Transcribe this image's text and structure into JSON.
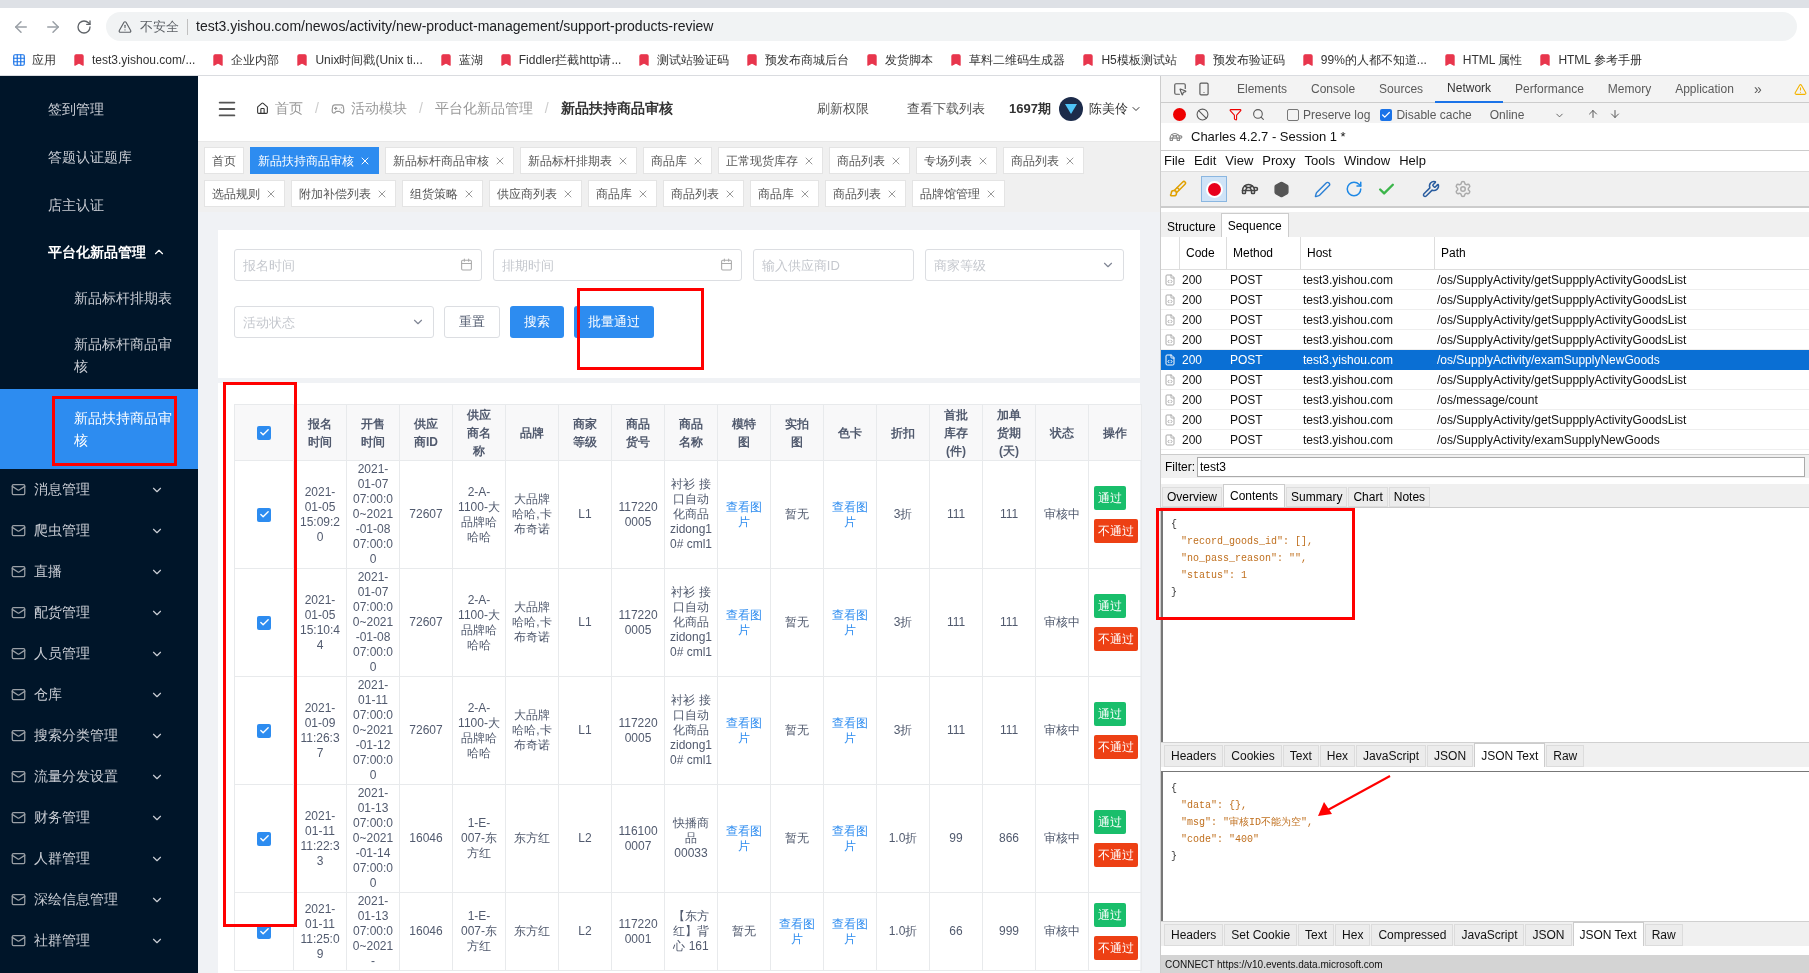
{
  "browser": {
    "security": "不安全",
    "url": "test3.yishou.com/newos/activity/new-product-management/support-products-review",
    "bookmarks": [
      {
        "kind": "apps",
        "label": "应用"
      },
      {
        "kind": "link",
        "label": "test3.yishou.com/..."
      },
      {
        "kind": "link",
        "label": "企业内部"
      },
      {
        "kind": "link",
        "label": "Unix时间戳(Unix ti..."
      },
      {
        "kind": "link",
        "label": "蓝湖"
      },
      {
        "kind": "link",
        "label": "Fiddler拦截http请..."
      },
      {
        "kind": "link",
        "label": "测试站验证码"
      },
      {
        "kind": "link",
        "label": "预发布商城后台"
      },
      {
        "kind": "link",
        "label": "发货脚本"
      },
      {
        "kind": "link",
        "label": "草料二维码生成器"
      },
      {
        "kind": "link",
        "label": "H5模板测试站"
      },
      {
        "kind": "link",
        "label": "预发布验证码"
      },
      {
        "kind": "link",
        "label": "99%的人都不知道..."
      },
      {
        "kind": "link",
        "label": "HTML 属性"
      },
      {
        "kind": "link",
        "label": "HTML 参考手册"
      }
    ]
  },
  "sidebar": {
    "items": [
      {
        "kind": "link",
        "label": "签到管理"
      },
      {
        "kind": "link",
        "label": "答题认证题库"
      },
      {
        "kind": "link",
        "label": "店主认证"
      },
      {
        "kind": "section",
        "label": "平台化新品管理",
        "expanded": true,
        "children": [
          {
            "label": "新品标杆排期表",
            "selected": false
          },
          {
            "label": "新品标杆商品审核",
            "selected": false
          },
          {
            "label": "新品扶持商品审核",
            "selected": true
          }
        ]
      },
      {
        "kind": "menu",
        "label": "消息管理",
        "expanded": false
      },
      {
        "kind": "menu",
        "label": "爬虫管理",
        "expanded": false
      },
      {
        "kind": "menu",
        "label": "直播",
        "expanded": false
      },
      {
        "kind": "menu",
        "label": "配货管理",
        "expanded": false
      },
      {
        "kind": "menu",
        "label": "人员管理",
        "expanded": false
      },
      {
        "kind": "menu",
        "label": "仓库",
        "expanded": false
      },
      {
        "kind": "menu",
        "label": "搜索分类管理",
        "expanded": false
      },
      {
        "kind": "menu",
        "label": "流量分发设置",
        "expanded": false
      },
      {
        "kind": "menu",
        "label": "财务管理",
        "expanded": false
      },
      {
        "kind": "menu",
        "label": "人群管理",
        "expanded": false
      },
      {
        "kind": "menu",
        "label": "深绘信息管理",
        "expanded": false
      },
      {
        "kind": "menu",
        "label": "社群管理",
        "expanded": false
      }
    ]
  },
  "header": {
    "separator": "/",
    "breadcrumbs": [
      "首页",
      "活动模块",
      "平台化新品管理",
      "新品扶持商品审核"
    ],
    "actions": [
      "刷新权限",
      "查看下载列表"
    ],
    "period": "1697期",
    "user": "陈美伶"
  },
  "tab_rows": [
    [
      {
        "label": "首页",
        "selected": false,
        "closable": false
      },
      {
        "label": "新品扶持商品审核",
        "selected": true,
        "closable": true
      },
      {
        "label": "新品标杆商品审核",
        "selected": false,
        "closable": true
      },
      {
        "label": "新品标杆排期表",
        "selected": false,
        "closable": true
      },
      {
        "label": "商品库",
        "selected": false,
        "closable": true
      },
      {
        "label": "正常现货库存",
        "selected": false,
        "closable": true
      },
      {
        "label": "商品列表",
        "selected": false,
        "closable": true
      },
      {
        "label": "专场列表",
        "selected": false,
        "closable": true
      },
      {
        "label": "商品列表",
        "selected": false,
        "closable": true
      }
    ],
    [
      {
        "label": "选品规则",
        "selected": false,
        "closable": true
      },
      {
        "label": "附加补偿列表",
        "selected": false,
        "closable": true
      },
      {
        "label": "组货策略",
        "selected": false,
        "closable": true
      },
      {
        "label": "供应商列表",
        "selected": false,
        "closable": true
      },
      {
        "label": "商品库",
        "selected": false,
        "closable": true
      },
      {
        "label": "商品列表",
        "selected": false,
        "closable": true
      },
      {
        "label": "商品库",
        "selected": false,
        "closable": true
      },
      {
        "label": "商品列表",
        "selected": false,
        "closable": true
      },
      {
        "label": "品牌馆管理",
        "selected": false,
        "closable": true
      }
    ]
  ],
  "filters": {
    "fields": [
      {
        "kind": "date",
        "placeholder": "报名时间"
      },
      {
        "kind": "date",
        "placeholder": "排期时间"
      },
      {
        "kind": "text",
        "placeholder": "输入供应商ID"
      },
      {
        "kind": "select",
        "placeholder": "商家等级"
      }
    ],
    "status": {
      "kind": "select",
      "placeholder": "活动状态"
    },
    "buttons": [
      {
        "kind": "default",
        "label": "重置"
      },
      {
        "kind": "primary",
        "label": "搜索"
      },
      {
        "kind": "primary",
        "label": "批量通过"
      }
    ]
  },
  "table": {
    "all_checked": true,
    "columns": [
      "报名时间",
      "开售时间",
      "供应商ID",
      "供应商名称",
      "品牌",
      "商家等级",
      "商品货号",
      "商品名称",
      "模特图",
      "实拍图",
      "色卡",
      "折扣",
      "首批库存(件)",
      "加单货期(天)",
      "状态",
      "操作"
    ],
    "rows": [
      {
        "checked": true,
        "cells": [
          {
            "kind": "text",
            "text": "2021-01-05 15:09:20"
          },
          {
            "kind": "text",
            "text": "2021-01-07 07:00:00~2021-01-08 07:00:00"
          },
          {
            "kind": "text",
            "text": "72607"
          },
          {
            "kind": "text",
            "text": "2-A-1100-大品牌哈哈哈"
          },
          {
            "kind": "text",
            "text": "大品牌哈哈,卡布奇诺"
          },
          {
            "kind": "text",
            "text": "L1"
          },
          {
            "kind": "text",
            "text": "1172200005"
          },
          {
            "kind": "text",
            "text": "衬衫 接口自动化商品zidong10# cml1"
          },
          {
            "kind": "link",
            "text": "查看图片"
          },
          {
            "kind": "text",
            "text": "暂无"
          },
          {
            "kind": "link",
            "text": "查看图片"
          },
          {
            "kind": "text",
            "text": "3折"
          },
          {
            "kind": "text",
            "text": "111"
          },
          {
            "kind": "text",
            "text": "111"
          },
          {
            "kind": "text",
            "text": "审核中"
          }
        ],
        "actions": [
          {
            "kind": "pass",
            "label": "通过"
          },
          {
            "kind": "reject",
            "label": "不通过"
          }
        ]
      },
      {
        "checked": true,
        "cells": [
          {
            "kind": "text",
            "text": "2021-01-05 15:10:44"
          },
          {
            "kind": "text",
            "text": "2021-01-07 07:00:00~2021-01-08 07:00:00"
          },
          {
            "kind": "text",
            "text": "72607"
          },
          {
            "kind": "text",
            "text": "2-A-1100-大品牌哈哈哈"
          },
          {
            "kind": "text",
            "text": "大品牌哈哈,卡布奇诺"
          },
          {
            "kind": "text",
            "text": "L1"
          },
          {
            "kind": "text",
            "text": "1172200005"
          },
          {
            "kind": "text",
            "text": "衬衫 接口自动化商品zidong10# cml1"
          },
          {
            "kind": "link",
            "text": "查看图片"
          },
          {
            "kind": "text",
            "text": "暂无"
          },
          {
            "kind": "link",
            "text": "查看图片"
          },
          {
            "kind": "text",
            "text": "3折"
          },
          {
            "kind": "text",
            "text": "111"
          },
          {
            "kind": "text",
            "text": "111"
          },
          {
            "kind": "text",
            "text": "审核中"
          }
        ],
        "actions": [
          {
            "kind": "pass",
            "label": "通过"
          },
          {
            "kind": "reject",
            "label": "不通过"
          }
        ]
      },
      {
        "checked": true,
        "cells": [
          {
            "kind": "text",
            "text": "2021-01-09 11:26:37"
          },
          {
            "kind": "text",
            "text": "2021-01-11 07:00:00~2021-01-12 07:00:00"
          },
          {
            "kind": "text",
            "text": "72607"
          },
          {
            "kind": "text",
            "text": "2-A-1100-大品牌哈哈哈"
          },
          {
            "kind": "text",
            "text": "大品牌哈哈,卡布奇诺"
          },
          {
            "kind": "text",
            "text": "L1"
          },
          {
            "kind": "text",
            "text": "1172200005"
          },
          {
            "kind": "text",
            "text": "衬衫 接口自动化商品zidong10# cml1"
          },
          {
            "kind": "link",
            "text": "查看图片"
          },
          {
            "kind": "text",
            "text": "暂无"
          },
          {
            "kind": "link",
            "text": "查看图片"
          },
          {
            "kind": "text",
            "text": "3折"
          },
          {
            "kind": "text",
            "text": "111"
          },
          {
            "kind": "text",
            "text": "111"
          },
          {
            "kind": "text",
            "text": "审核中"
          }
        ],
        "actions": [
          {
            "kind": "pass",
            "label": "通过"
          },
          {
            "kind": "reject",
            "label": "不通过"
          }
        ]
      },
      {
        "checked": true,
        "cells": [
          {
            "kind": "text",
            "text": "2021-01-11 11:22:33"
          },
          {
            "kind": "text",
            "text": "2021-01-13 07:00:00~2021-01-14 07:00:00"
          },
          {
            "kind": "text",
            "text": "16046"
          },
          {
            "kind": "text",
            "text": "1-E-007-东方红"
          },
          {
            "kind": "text",
            "text": "东方红"
          },
          {
            "kind": "text",
            "text": "L2"
          },
          {
            "kind": "text",
            "text": "1161000007"
          },
          {
            "kind": "text",
            "text": "快播商品 00033"
          },
          {
            "kind": "link",
            "text": "查看图片"
          },
          {
            "kind": "text",
            "text": "暂无"
          },
          {
            "kind": "link",
            "text": "查看图片"
          },
          {
            "kind": "text",
            "text": "1.0折"
          },
          {
            "kind": "text",
            "text": "99"
          },
          {
            "kind": "text",
            "text": "866"
          },
          {
            "kind": "text",
            "text": "审核中"
          }
        ],
        "actions": [
          {
            "kind": "pass",
            "label": "通过"
          },
          {
            "kind": "reject",
            "label": "不通过"
          }
        ]
      },
      {
        "checked": true,
        "cells": [
          {
            "kind": "text",
            "text": "2021-01-11 11:25:09"
          },
          {
            "kind": "text",
            "text": "2021-01-13 07:00:00~2021-"
          },
          {
            "kind": "text",
            "text": "16046"
          },
          {
            "kind": "text",
            "text": "1-E-007-东方红"
          },
          {
            "kind": "text",
            "text": "东方红"
          },
          {
            "kind": "text",
            "text": "L2"
          },
          {
            "kind": "text",
            "text": "1172200001"
          },
          {
            "kind": "text",
            "text": "【东方红】背心 161"
          },
          {
            "kind": "text",
            "text": "暂无"
          },
          {
            "kind": "link",
            "text": "查看图片"
          },
          {
            "kind": "link",
            "text": "查看图片"
          },
          {
            "kind": "text",
            "text": "1.0折"
          },
          {
            "kind": "text",
            "text": "66"
          },
          {
            "kind": "text",
            "text": "999"
          },
          {
            "kind": "text",
            "text": "审核中"
          }
        ],
        "actions": [
          {
            "kind": "pass",
            "label": "通过"
          },
          {
            "kind": "reject",
            "label": "不通过"
          }
        ]
      }
    ]
  },
  "devtools": {
    "tabs": [
      {
        "label": "Elements",
        "selected": false
      },
      {
        "label": "Console",
        "selected": false
      },
      {
        "label": "Sources",
        "selected": false
      },
      {
        "label": "Network",
        "selected": true
      },
      {
        "label": "Performance",
        "selected": false
      },
      {
        "label": "Memory",
        "selected": false
      },
      {
        "label": "Application",
        "selected": false
      }
    ],
    "more": "»",
    "preserve_log": {
      "label": "Preserve log",
      "checked": false
    },
    "disable_cache": {
      "label": "Disable cache",
      "checked": true
    },
    "throttle": "Online"
  },
  "charles": {
    "title": "Charles 4.2.7 - Session 1 *",
    "menu": [
      "File",
      "Edit",
      "View",
      "Proxy",
      "Tools",
      "Window",
      "Help"
    ],
    "view_tabs": [
      {
        "label": "Structure",
        "selected": false
      },
      {
        "label": "Sequence",
        "selected": true
      }
    ],
    "columns": [
      "Code",
      "Method",
      "Host",
      "Path"
    ],
    "rows": [
      {
        "selected": false,
        "code": "200",
        "method": "POST",
        "host": "test3.yishou.com",
        "path": "/os/SupplyActivity/getSuppplyActivityGoodsList"
      },
      {
        "selected": false,
        "code": "200",
        "method": "POST",
        "host": "test3.yishou.com",
        "path": "/os/SupplyActivity/getSuppplyActivityGoodsList"
      },
      {
        "selected": false,
        "code": "200",
        "method": "POST",
        "host": "test3.yishou.com",
        "path": "/os/SupplyActivity/getSuppplyActivityGoodsList"
      },
      {
        "selected": false,
        "code": "200",
        "method": "POST",
        "host": "test3.yishou.com",
        "path": "/os/SupplyActivity/getSuppplyActivityGoodsList"
      },
      {
        "selected": true,
        "code": "200",
        "method": "POST",
        "host": "test3.yishou.com",
        "path": "/os/SupplyActivity/examSupplyNewGoods"
      },
      {
        "selected": false,
        "code": "200",
        "method": "POST",
        "host": "test3.yishou.com",
        "path": "/os/SupplyActivity/getSuppplyActivityGoodsList"
      },
      {
        "selected": false,
        "code": "200",
        "method": "POST",
        "host": "test3.yishou.com",
        "path": "/os/message/count"
      },
      {
        "selected": false,
        "code": "200",
        "method": "POST",
        "host": "test3.yishou.com",
        "path": "/os/SupplyActivity/getSuppplyActivityGoodsList"
      },
      {
        "selected": false,
        "code": "200",
        "method": "POST",
        "host": "test3.yishou.com",
        "path": "/os/SupplyActivity/examSupplyNewGoods"
      }
    ],
    "filter": {
      "label": "Filter:",
      "value": "test3"
    },
    "detail_tabs": [
      {
        "label": "Overview",
        "selected": false
      },
      {
        "label": "Contents",
        "selected": true
      },
      {
        "label": "Summary",
        "selected": false
      },
      {
        "label": "Chart",
        "selected": false
      },
      {
        "label": "Notes",
        "selected": false
      }
    ],
    "request_lines": [
      {
        "kind": "brace",
        "text": "{"
      },
      {
        "kind": "entry",
        "text": "\"record_goods_id\": [],"
      },
      {
        "kind": "entry",
        "text": "\"no_pass_reason\": \"\","
      },
      {
        "kind": "entry",
        "text": "\"status\": 1"
      },
      {
        "kind": "brace",
        "text": "}"
      }
    ],
    "request_tabs": [
      {
        "label": "Headers",
        "selected": false
      },
      {
        "label": "Cookies",
        "selected": false
      },
      {
        "label": "Text",
        "selected": false
      },
      {
        "label": "Hex",
        "selected": false
      },
      {
        "label": "JavaScript",
        "selected": false
      },
      {
        "label": "JSON",
        "selected": false
      },
      {
        "label": "JSON Text",
        "selected": true
      },
      {
        "label": "Raw",
        "selected": false
      }
    ],
    "response_lines": [
      {
        "kind": "brace",
        "text": "{"
      },
      {
        "kind": "entry",
        "text": "\"data\": {},"
      },
      {
        "kind": "entry",
        "text": "\"msg\": \"审核ID不能为空\","
      },
      {
        "kind": "entry",
        "text": "\"code\": \"400\""
      },
      {
        "kind": "brace",
        "text": "}"
      }
    ],
    "response_tabs": [
      {
        "label": "Headers",
        "selected": false
      },
      {
        "label": "Set Cookie",
        "selected": false
      },
      {
        "label": "Text",
        "selected": false
      },
      {
        "label": "Hex",
        "selected": false
      },
      {
        "label": "Compressed",
        "selected": false
      },
      {
        "label": "JavaScript",
        "selected": false
      },
      {
        "label": "JSON",
        "selected": false
      },
      {
        "label": "JSON Text",
        "selected": true
      },
      {
        "label": "Raw",
        "selected": false
      }
    ],
    "status_bar": "CONNECT https://v10.events.data.microsoft.com"
  }
}
